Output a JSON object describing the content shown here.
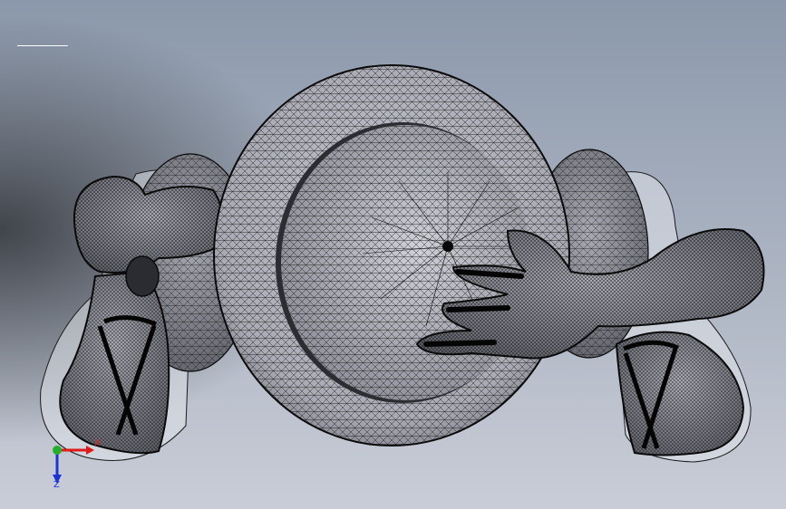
{
  "viewport": {
    "background_top": "#8b98ab",
    "background_bottom": "#c9cdd7",
    "background_left_shadow": "#3b3f45",
    "model_face_color": "#b9bac4",
    "model_shadow_color": "#6e7079",
    "wire_color": "#0a0a0a",
    "silhouette_color": "#dfe1e8"
  },
  "view_divider": {
    "color": "#ffffff"
  },
  "triad": {
    "x_label": "X",
    "z_label": "Z",
    "x_color": "#e01a1a",
    "y_color": "#22b02a",
    "z_color": "#1c33d6"
  }
}
